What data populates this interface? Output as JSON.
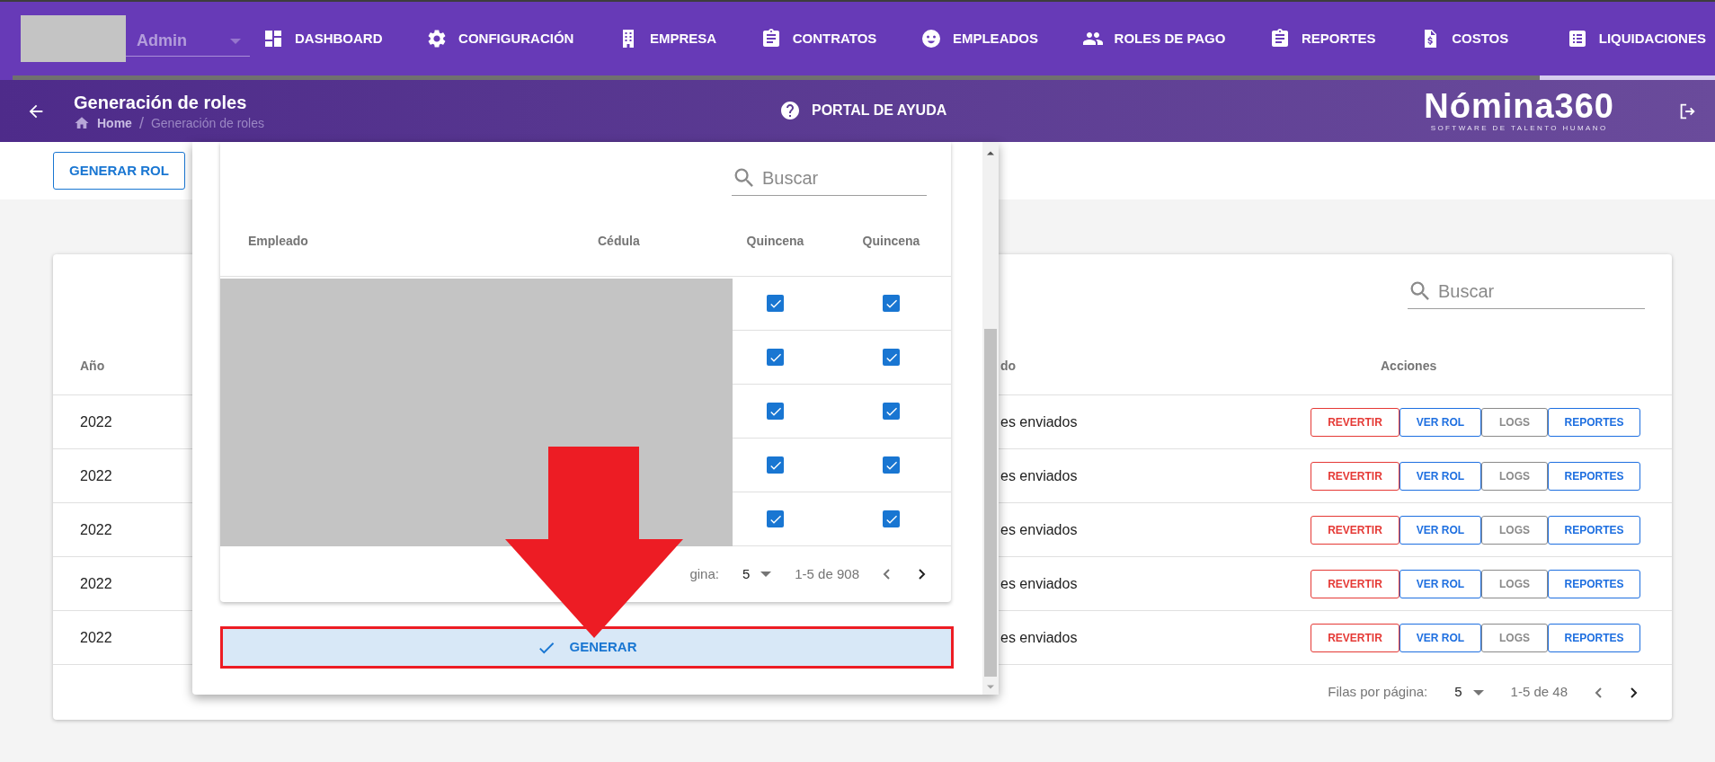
{
  "top_nav": {
    "user_select": {
      "value": "Admin"
    },
    "items": [
      {
        "label": "DASHBOARD",
        "selected": false
      },
      {
        "label": "CONFIGURACIÓN",
        "selected": false
      },
      {
        "label": "EMPRESA",
        "selected": false
      },
      {
        "label": "CONTRATOS",
        "selected": false
      },
      {
        "label": "EMPLEADOS",
        "selected": false
      },
      {
        "label": "ROLES DE PAGO",
        "selected": false
      },
      {
        "label": "REPORTES",
        "selected": false
      },
      {
        "label": "COSTOS",
        "selected": false
      },
      {
        "label": "LIQUIDACIONES",
        "selected": true
      }
    ]
  },
  "header": {
    "title": "Generación de roles",
    "breadcrumbs": [
      "Home",
      "/",
      "Generación de roles"
    ],
    "help_link": "PORTAL DE AYUDA",
    "logo": {
      "name": "Nómina360",
      "tagline": "SOFTWARE DE TALENTO HUMANO"
    }
  },
  "toolbar": {
    "generate_button": "GENERAR ROL"
  },
  "table": {
    "search": {
      "placeholder": "Buscar"
    },
    "columns": [
      "Año",
      "do",
      "Acciones"
    ],
    "rows": [
      {
        "year": "2022",
        "column_2": "es enviados",
        "actions": [
          {
            "label": "REVERTIR",
            "kind": "danger"
          },
          {
            "label": "VER ROL",
            "kind": "primary"
          },
          {
            "label": "LOGS",
            "kind": "neutral"
          },
          {
            "label": "REPORTES",
            "kind": "primary"
          }
        ]
      },
      {
        "year": "2022",
        "column_2": "es enviados",
        "actions": [
          {
            "label": "REVERTIR",
            "kind": "danger"
          },
          {
            "label": "VER ROL",
            "kind": "primary"
          },
          {
            "label": "LOGS",
            "kind": "neutral"
          },
          {
            "label": "REPORTES",
            "kind": "primary"
          }
        ]
      },
      {
        "year": "2022",
        "column_2": "es enviados",
        "actions": [
          {
            "label": "REVERTIR",
            "kind": "danger"
          },
          {
            "label": "VER ROL",
            "kind": "primary"
          },
          {
            "label": "LOGS",
            "kind": "neutral"
          },
          {
            "label": "REPORTES",
            "kind": "primary"
          }
        ]
      },
      {
        "year": "2022",
        "column_2": "es enviados",
        "actions": [
          {
            "label": "REVERTIR",
            "kind": "danger"
          },
          {
            "label": "VER ROL",
            "kind": "primary"
          },
          {
            "label": "LOGS",
            "kind": "neutral"
          },
          {
            "label": "REPORTES",
            "kind": "primary"
          }
        ]
      },
      {
        "year": "2022",
        "column_2": "es enviados",
        "actions": [
          {
            "label": "REVERTIR",
            "kind": "danger"
          },
          {
            "label": "VER ROL",
            "kind": "primary"
          },
          {
            "label": "LOGS",
            "kind": "neutral"
          },
          {
            "label": "REPORTES",
            "kind": "primary"
          }
        ]
      }
    ],
    "pagination": {
      "rows_label": "Filas por página:",
      "rows_per_page": "5",
      "range": "1-5 de 48"
    }
  },
  "dialog": {
    "search": {
      "placeholder": "Buscar"
    },
    "columns": [
      "Empleado",
      "Cédula",
      "Quincena",
      "Quincena"
    ],
    "rows": [
      {
        "quincena_1": true,
        "quincena_2": true
      },
      {
        "quincena_1": true,
        "quincena_2": true
      },
      {
        "quincena_1": true,
        "quincena_2": true
      },
      {
        "quincena_1": true,
        "quincena_2": true
      },
      {
        "quincena_1": true,
        "quincena_2": true
      }
    ],
    "pagination": {
      "rows_label": "gina:",
      "rows_per_page": "5",
      "range": "1-5 de 908"
    },
    "generate_button": "GENERAR"
  }
}
